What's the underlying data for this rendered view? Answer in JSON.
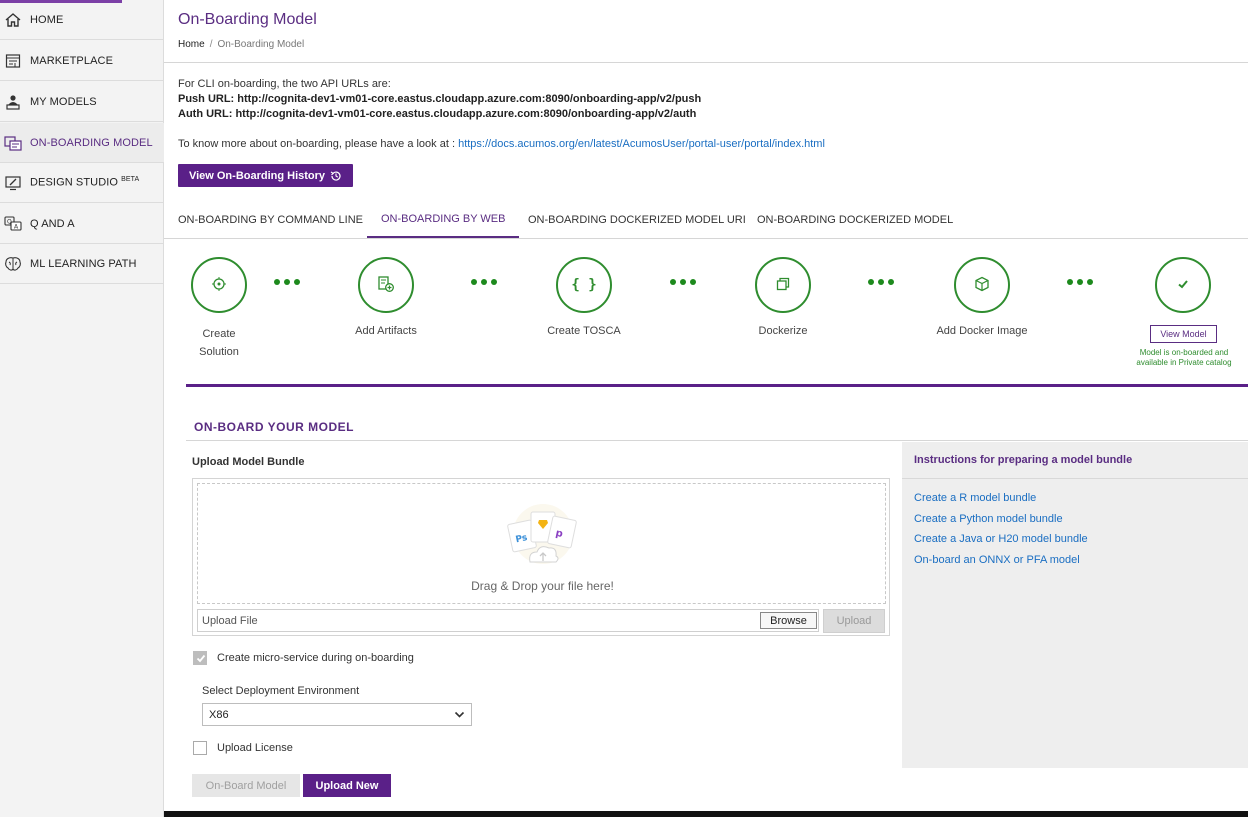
{
  "sidebar": {
    "items": [
      {
        "label": "HOME",
        "icon": "home-icon"
      },
      {
        "label": "MARKETPLACE",
        "icon": "store-icon"
      },
      {
        "label": "MY MODELS",
        "icon": "user-models-icon"
      },
      {
        "label": "ON-BOARDING MODEL",
        "icon": "onboarding-icon",
        "active": true
      },
      {
        "label": "DESIGN STUDIO",
        "sup": "BETA",
        "icon": "design-studio-icon"
      },
      {
        "label": "Q AND A",
        "icon": "qa-icon"
      },
      {
        "label": "ML LEARNING PATH",
        "icon": "brain-icon"
      }
    ]
  },
  "header": {
    "title": "On-Boarding Model",
    "breadcrumb": {
      "home": "Home",
      "separator": "/",
      "current": "On-Boarding Model"
    }
  },
  "info": {
    "cli_intro": "For CLI on-boarding, the two API URLs are:",
    "push_label": "Push URL:",
    "push_url": "http://cognita-dev1-vm01-core.eastus.cloudapp.azure.com:8090/onboarding-app/v2/push",
    "auth_label": "Auth URL:",
    "auth_url": "http://cognita-dev1-vm01-core.eastus.cloudapp.azure.com:8090/onboarding-app/v2/auth",
    "more_text": "To know more about on-boarding, please have a look at :",
    "docs_link": "https://docs.acumos.org/en/latest/AcumosUser/portal-user/portal/index.html"
  },
  "history_button": "View On-Boarding History",
  "tabs": [
    {
      "label": "ON-BOARDING BY COMMAND LINE"
    },
    {
      "label": "ON-BOARDING BY WEB",
      "active": true
    },
    {
      "label": "ON-BOARDING DOCKERIZED MODEL URI"
    },
    {
      "label": "ON-BOARDING DOCKERIZED MODEL"
    }
  ],
  "steps": [
    {
      "line1": "Create",
      "line2": "Solution",
      "icon": "target-icon"
    },
    {
      "line1": "Add Artifacts",
      "icon": "add-artifact-icon"
    },
    {
      "line1": "Create TOSCA",
      "icon": "braces-icon"
    },
    {
      "line1": "Dockerize",
      "icon": "copy-icon"
    },
    {
      "line1": "Add Docker Image",
      "icon": "cube-icon"
    },
    {
      "icon": "check-icon"
    }
  ],
  "view_model_button": "View Model",
  "onboard_note": "Model is on-boarded and available in Private catalog",
  "onboard": {
    "section_title": "ON-BOARD YOUR MODEL",
    "upload_title": "Upload Model Bundle",
    "drop_text": "Drag & Drop your file here!",
    "file_placeholder": "Upload File",
    "browse_label": "Browse",
    "upload_label": "Upload",
    "microservice_label": "Create micro-service during on-boarding",
    "env_label": "Select Deployment Environment",
    "env_value": "X86",
    "license_label": "Upload License",
    "onboard_button": "On-Board Model",
    "upload_new_button": "Upload New"
  },
  "instructions": {
    "title": "Instructions for preparing a model bundle",
    "links": [
      "Create a R model bundle",
      "Create a Python model bundle",
      "Create a Java or H20 model bundle",
      "On-board an ONNX or PFA model"
    ]
  },
  "colors": {
    "accent": "#5a2088",
    "step_green": "#2f8d2f",
    "link": "#1a6ec2"
  }
}
